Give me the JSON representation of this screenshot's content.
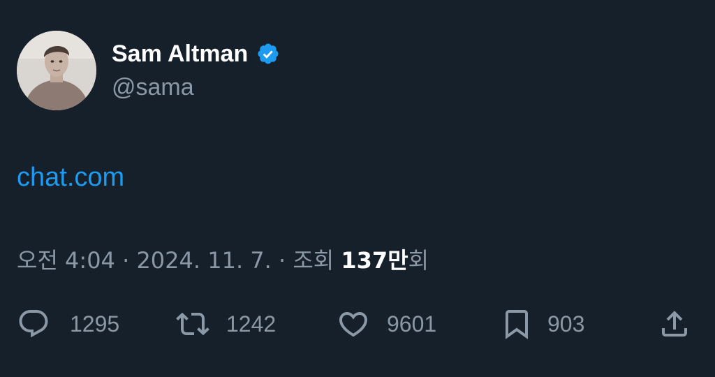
{
  "author": {
    "display_name": "Sam Altman",
    "handle": "@sama",
    "verified": true,
    "verified_color": "#1d9bf0"
  },
  "tweet": {
    "link_text": "chat.com",
    "link_color": "#1d9bf0"
  },
  "meta": {
    "time": "오전 4:04",
    "separator": " · ",
    "date": "2024. 11. 7.",
    "views_label": "조회",
    "views_count": "137",
    "views_unit": "만",
    "views_suffix": "회"
  },
  "actions": {
    "replies": "1295",
    "retweets": "1242",
    "likes": "9601",
    "bookmarks": "903"
  },
  "icons": {
    "reply": "speech-bubble-icon",
    "retweet": "retweet-arrows-icon",
    "like": "heart-icon",
    "bookmark": "bookmark-icon",
    "share": "share-upload-icon"
  },
  "colors": {
    "background": "#15202b",
    "text_primary": "#ffffff",
    "text_secondary": "#8b98a5"
  }
}
